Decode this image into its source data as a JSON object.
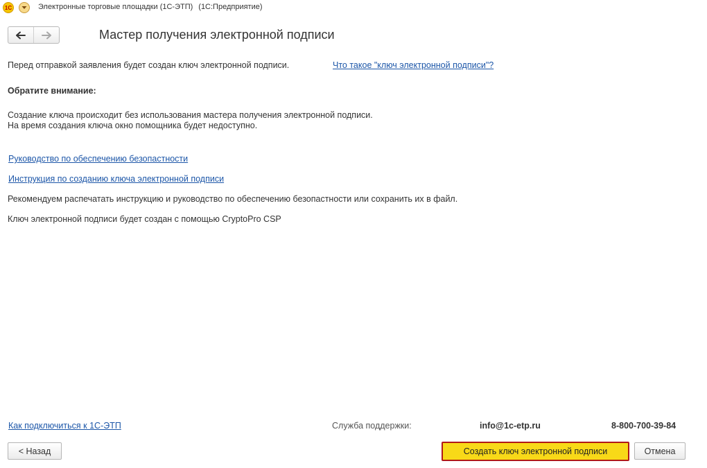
{
  "titlebar": {
    "logo_text": "1С",
    "app_name": "Электронные торговые площадки (1С-ЭТП)",
    "platform": "(1С:Предприятие)"
  },
  "header": {
    "title": "Мастер получения электронной подписи"
  },
  "content": {
    "intro": "Перед отправкой заявления будет создан ключ электронной подписи.",
    "what_is_key_link": "Что такое \"ключ электронной подписи\"?",
    "attention": "Обратите внимание:",
    "note_line1": "Создание ключа происходит без использования мастера получения электронной подписи.",
    "note_line2": "На время создания ключа окно помощника будет недоступно.",
    "security_guide_link": "Руководство по обеспечению безопастности",
    "instruction_link": "Инструкция по созданию ключа электронной подписи",
    "recommendation": "Рекомендуем распечатать инструкцию и руководство по обеспечению безопастности или сохранить их в файл.",
    "crypto_note": "Ключ электронной подписи будет создан с помощью CryptoPro CSP"
  },
  "footer": {
    "connect_link": "Как подключиться к 1С-ЭТП",
    "support_label": "Служба поддержки:",
    "support_email": "info@1c-etp.ru",
    "support_phone": "8-800-700-39-84",
    "back_button": "< Назад",
    "create_button": "Создать ключ электронной подписи",
    "cancel_button": "Отмена"
  },
  "colors": {
    "link": "#1c56a8",
    "primary_button": "#f8d918",
    "primary_button_border": "#b01818"
  },
  "icons": {
    "logo": "1c-logo-icon",
    "menu": "menu-chevron-icon",
    "back": "arrow-left-icon",
    "forward": "arrow-right-icon"
  }
}
